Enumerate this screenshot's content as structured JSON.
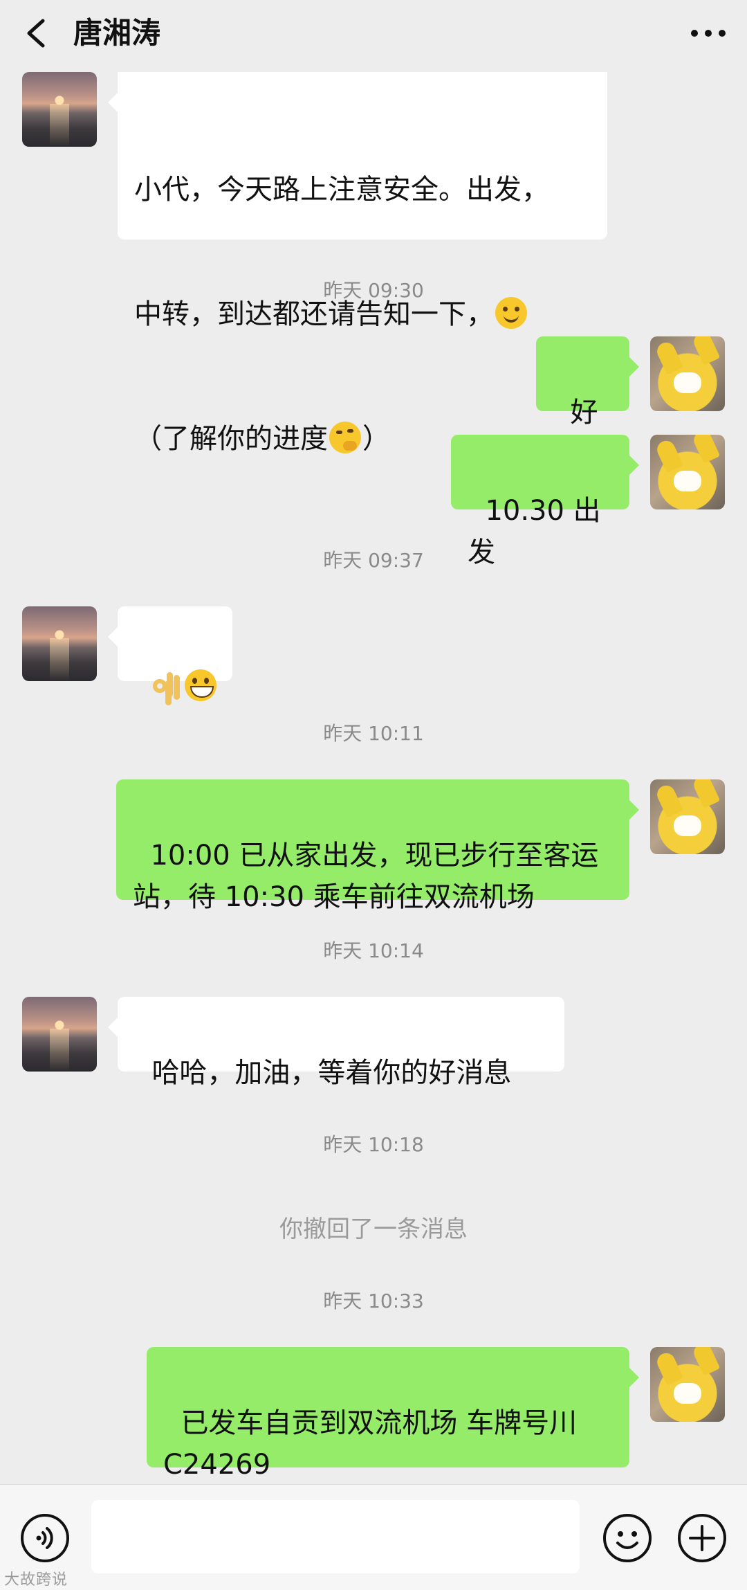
{
  "header": {
    "title": "唐湘涛"
  },
  "messages": {
    "m1": {
      "text_line1": "小代，今天路上注意安全。出发，",
      "text_line2": "中转，到达都还请告知一下，",
      "text_line3_a": "（了解你的进度",
      "text_line3_b": "）",
      "emoji_1": "smile",
      "emoji_2": "think"
    },
    "ts1": "昨天 09:30",
    "m2": {
      "text": "好的"
    },
    "m3": {
      "text": "10.30 出发"
    },
    "ts2": "昨天 09:37",
    "m4": {
      "emoji_1": "ok-hand",
      "emoji_2": "grin"
    },
    "ts3": "昨天 10:11",
    "m5": {
      "text": "10:00 已从家出发，现已步行至客运\n站，待 10:30 乘车前往双流机场"
    },
    "ts4": "昨天 10:14",
    "m6": {
      "text": "哈哈，加油，等着你的好消息"
    },
    "ts5": "昨天 10:18",
    "recall": "你撤回了一条消息",
    "ts6": "昨天 10:33",
    "m7": {
      "text": "已发车自贡到双流机场 车牌号川\nC24269"
    }
  },
  "input": {
    "value": ""
  },
  "icons": {
    "back": "chevron-left-icon",
    "more": "more-dots-icon",
    "voice": "voice-icon",
    "emoji": "emoji-icon",
    "plus": "plus-icon"
  },
  "colors": {
    "background": "#ededed",
    "bubble_self": "#95ec69",
    "bubble_other": "#ffffff"
  },
  "watermark": "大故跨说"
}
